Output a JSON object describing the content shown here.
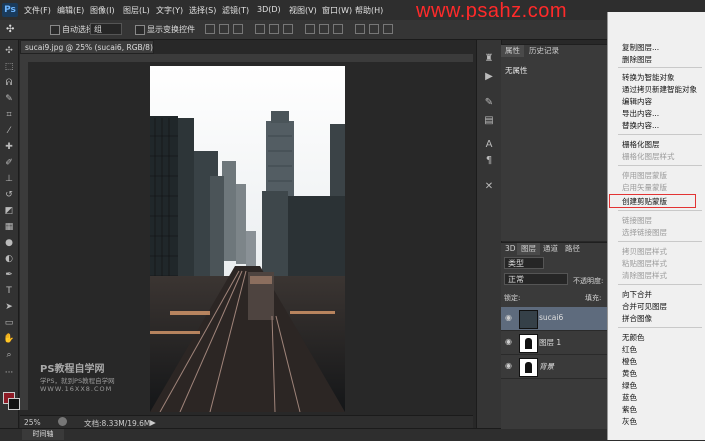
{
  "app": {
    "logo": "Ps"
  },
  "menu": [
    "文件(F)",
    "编辑(E)",
    "图像(I)",
    "图层(L)",
    "文字(Y)",
    "选择(S)",
    "滤镜(T)",
    "3D(D)",
    "视图(V)",
    "窗口(W)",
    "帮助(H)"
  ],
  "watermark": "www.psahz.com",
  "options": {
    "auto_select_label": "自动选择：",
    "auto_select_value": "组",
    "show_transform_label": "显示变换控件"
  },
  "document": {
    "tab_title": "sucai9.jpg @ 25% (sucai6, RGB/8) *",
    "close": "×"
  },
  "status": {
    "zoom": "25%",
    "doc_info": "文档:8.33M/19.6M",
    "arrow": "▶"
  },
  "timeline": {
    "label": "时间轴"
  },
  "credit": {
    "title": "PS教程自学网",
    "line1": "学PS，就到PS教程自学网",
    "line2": "WWW.16XX8.COM"
  },
  "properties": {
    "tab1": "属性",
    "tab2": "历史记录",
    "content": "无属性"
  },
  "layers": {
    "tabs": [
      "3D",
      "图层",
      "通道",
      "路径"
    ],
    "kind_filter": "类型",
    "blend_mode": "正常",
    "opacity_label": "不透明度:",
    "lock_label": "锁定:",
    "fill_label": "填充:",
    "items": [
      {
        "name": "sucai6",
        "selected": true
      },
      {
        "name": "图层 1",
        "selected": false
      },
      {
        "name": "背景",
        "selected": false
      }
    ]
  },
  "context_menu": {
    "items": [
      {
        "label": "复制图层...",
        "disabled": false
      },
      {
        "label": "删除图层",
        "disabled": false
      },
      {
        "label": "---"
      },
      {
        "label": "转换为智能对象",
        "disabled": false
      },
      {
        "label": "通过拷贝新建智能对象",
        "disabled": false
      },
      {
        "label": "编辑内容",
        "disabled": false
      },
      {
        "label": "导出内容...",
        "disabled": false
      },
      {
        "label": "替换内容...",
        "disabled": false
      },
      {
        "label": "---"
      },
      {
        "label": "栅格化图层",
        "disabled": false
      },
      {
        "label": "栅格化图层样式",
        "disabled": true
      },
      {
        "label": "---"
      },
      {
        "label": "停用图层蒙版",
        "disabled": true
      },
      {
        "label": "启用矢量蒙版",
        "disabled": true
      },
      {
        "label": "创建剪贴蒙版",
        "disabled": false,
        "highlighted": true
      },
      {
        "label": "---"
      },
      {
        "label": "链接图层",
        "disabled": true
      },
      {
        "label": "选择链接图层",
        "disabled": true
      },
      {
        "label": "---"
      },
      {
        "label": "拷贝图层样式",
        "disabled": true
      },
      {
        "label": "粘贴图层样式",
        "disabled": true
      },
      {
        "label": "清除图层样式",
        "disabled": true
      },
      {
        "label": "---"
      },
      {
        "label": "向下合并",
        "disabled": false
      },
      {
        "label": "合并可见图层",
        "disabled": false
      },
      {
        "label": "拼合图像",
        "disabled": false
      },
      {
        "label": "---"
      },
      {
        "label": "无颜色",
        "disabled": false
      },
      {
        "label": "红色",
        "disabled": false
      },
      {
        "label": "橙色",
        "disabled": false
      },
      {
        "label": "黄色",
        "disabled": false
      },
      {
        "label": "绿色",
        "disabled": false
      },
      {
        "label": "蓝色",
        "disabled": false
      },
      {
        "label": "紫色",
        "disabled": false
      },
      {
        "label": "灰色",
        "disabled": false
      }
    ],
    "highlight_color": "#e23333"
  }
}
